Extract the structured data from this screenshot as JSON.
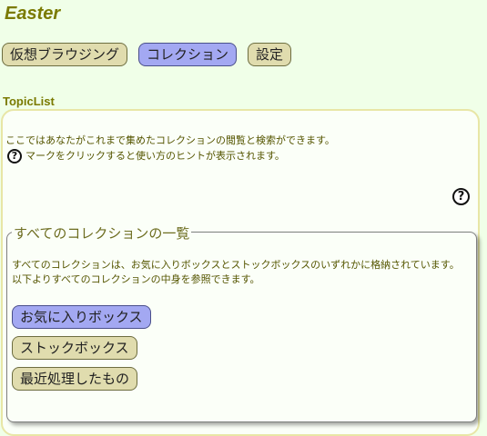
{
  "app": {
    "title": "Easter"
  },
  "nav": {
    "items": [
      {
        "label": "仮想ブラウジング",
        "active": false
      },
      {
        "label": "コレクション",
        "active": true
      },
      {
        "label": "設定",
        "active": false
      }
    ]
  },
  "topic": {
    "section_label": "TopicList",
    "intro_line1": "ここではあなたがこれまで集めたコレクションの閲覧と検索ができます。",
    "intro_line2": "マークをクリックすると使い方のヒントが表示されます。",
    "help_icon_glyph": "?"
  },
  "collections": {
    "legend": "すべてのコレクションの一覧",
    "desc_line1": "すべてのコレクションは、お気に入りボックスとストックボックスのいずれかに格納されています。",
    "desc_line2": "以下よりすべてのコレクションの中身を参照できます。",
    "buttons": [
      {
        "label": "お気に入りボックス",
        "active": true
      },
      {
        "label": "ストックボックス",
        "active": false
      },
      {
        "label": "最近処理したもの",
        "active": false
      }
    ]
  },
  "colors": {
    "background": "#f0ffe8",
    "accent_title": "#7a7a00",
    "pill": "#e0dcae",
    "pill_active": "#a3a8f2"
  }
}
